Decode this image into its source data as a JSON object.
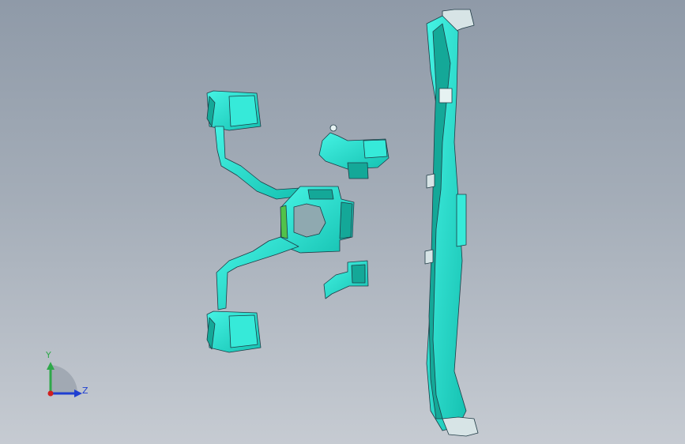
{
  "viewport": {
    "background_top": "#8f9aa8",
    "background_bottom": "#c6cbd2"
  },
  "model": {
    "part_color": "#27e6d6",
    "part_shadow": "#14a898",
    "edge_color": "#1f3b45",
    "highlight_color": "#52c24a",
    "parts": [
      "duct-left-assembly",
      "duct-center-upper",
      "duct-center-lower",
      "cross-car-beam"
    ]
  },
  "triad": {
    "y_label": "Y",
    "z_label": "Z",
    "y_color": "#2ea84a",
    "z_color": "#1f3fd1",
    "x_color": "#d11f1f"
  }
}
